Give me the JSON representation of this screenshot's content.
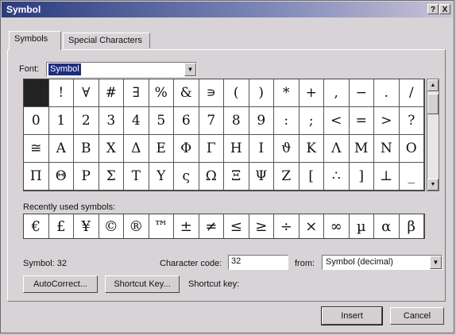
{
  "window": {
    "title": "Symbol",
    "help_label": "?",
    "close_label": "X"
  },
  "tabs": [
    {
      "label": "Symbols"
    },
    {
      "label": "Special Characters"
    }
  ],
  "font": {
    "label": "Font:",
    "value": "Symbol"
  },
  "symbols": {
    "rows": [
      [
        " ",
        "!",
        "∀",
        "#",
        "∃",
        "%",
        "&",
        "∍",
        "(",
        ")",
        "*",
        "+",
        ",",
        "−",
        ".",
        "/"
      ],
      [
        "0",
        "1",
        "2",
        "3",
        "4",
        "5",
        "6",
        "7",
        "8",
        "9",
        ":",
        ";",
        "<",
        "=",
        ">",
        "?"
      ],
      [
        "≅",
        "Α",
        "Β",
        "Χ",
        "Δ",
        "Ε",
        "Φ",
        "Γ",
        "Η",
        "Ι",
        "ϑ",
        "Κ",
        "Λ",
        "Μ",
        "Ν",
        "Ο"
      ],
      [
        "Π",
        "Θ",
        "Ρ",
        "Σ",
        "Τ",
        "Υ",
        "ς",
        "Ω",
        "Ξ",
        "Ψ",
        "Ζ",
        "[",
        "∴",
        "]",
        "⊥",
        "_"
      ]
    ]
  },
  "recent": {
    "label": "Recently used symbols:",
    "items": [
      "€",
      "£",
      "¥",
      "©",
      "®",
      "™",
      "±",
      "≠",
      "≤",
      "≥",
      "÷",
      "×",
      "∞",
      "µ",
      "α",
      "β"
    ]
  },
  "status": {
    "symbol_info": "Symbol: 32",
    "char_code_label": "Character code:",
    "char_code_value": "32",
    "from_label": "from:",
    "from_value": "Symbol (decimal)",
    "shortcut_key_label": "Shortcut key:"
  },
  "buttons": {
    "autocorrect": "AutoCorrect...",
    "shortcut": "Shortcut Key...",
    "insert": "Insert",
    "cancel": "Cancel"
  }
}
